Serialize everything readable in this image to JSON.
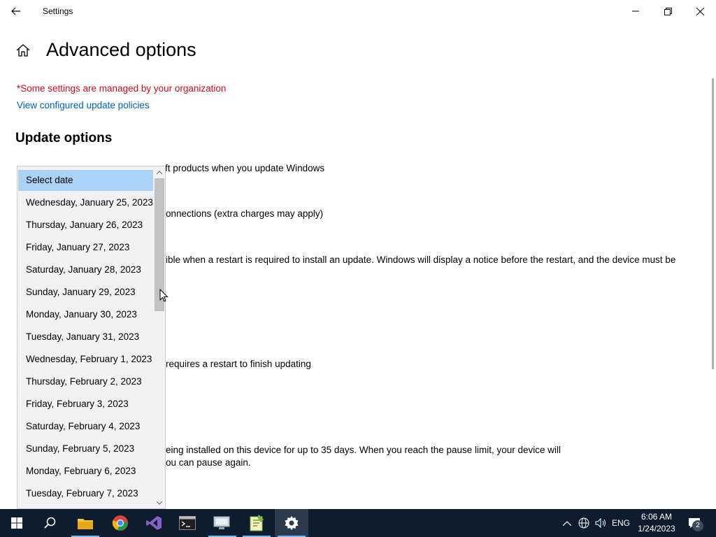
{
  "window": {
    "title": "Settings"
  },
  "page": {
    "title": "Advanced options",
    "managed_notice": "*Some settings are managed by your organization",
    "policies_link": "View configured update policies",
    "section_heading": "Update options"
  },
  "background_text": {
    "line1": "ft products when you update Windows",
    "line2": "onnections (extra charges may apply)",
    "line3": "ible when a restart is required to install an update. Windows will display a notice before the restart, and the device must be",
    "line4": "requires a restart to finish updating",
    "line5": "eing installed on this device for up to 35 days. When you reach the pause limit, your device will",
    "line6": "ou can pause again."
  },
  "dropdown": {
    "items": [
      "Select date",
      "Wednesday, January 25, 2023",
      "Thursday, January 26, 2023",
      "Friday, January 27, 2023",
      "Saturday, January 28, 2023",
      "Sunday, January 29, 2023",
      "Monday, January 30, 2023",
      "Tuesday, January 31, 2023",
      "Wednesday, February 1, 2023",
      "Thursday, February 2, 2023",
      "Friday, February 3, 2023",
      "Saturday, February 4, 2023",
      "Sunday, February 5, 2023",
      "Monday, February 6, 2023",
      "Tuesday, February 7, 2023"
    ],
    "selected_index": 0
  },
  "taskbar": {
    "language": "ENG",
    "time": "6:06 AM",
    "date": "1/24/2023",
    "notification_count": "2"
  },
  "colors": {
    "managed_red": "#c50f1f",
    "link_blue": "#0063b1",
    "selected_item": "#a9d2f5",
    "taskbar": "#0e1c2e"
  }
}
